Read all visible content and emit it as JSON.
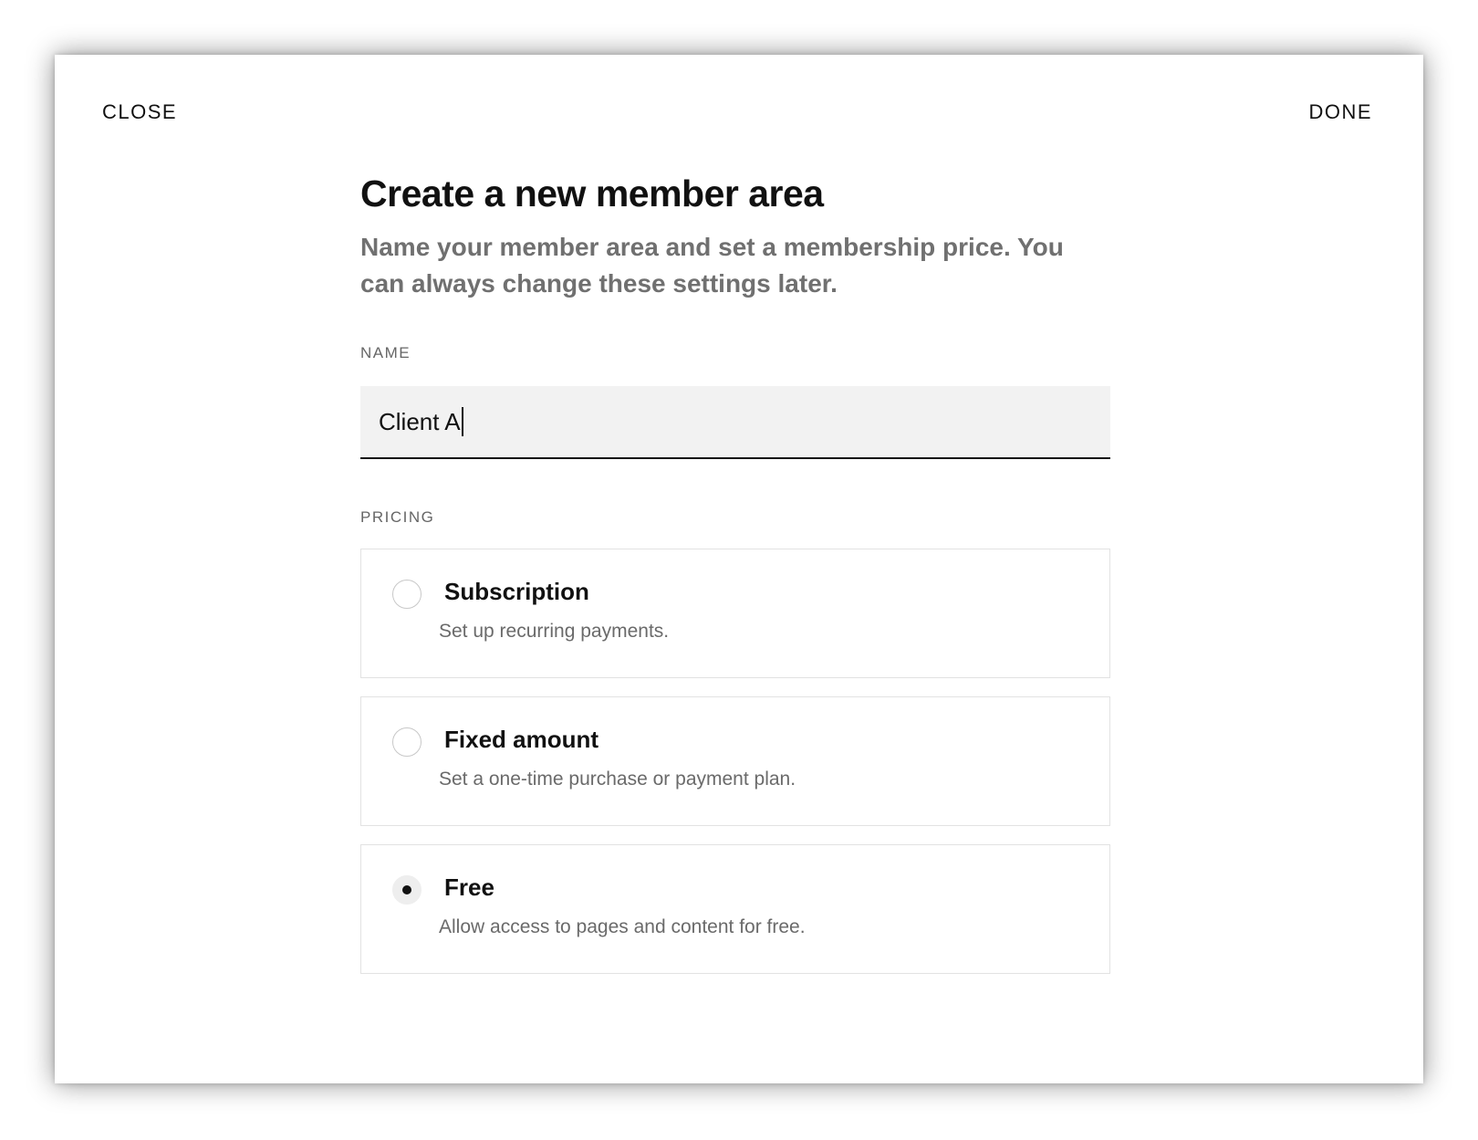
{
  "header": {
    "close_label": "CLOSE",
    "done_label": "DONE"
  },
  "main": {
    "title": "Create a new member area",
    "subtitle": "Name your member area and set a membership price. You can always change these settings later.",
    "name": {
      "label": "NAME",
      "value": "Client A"
    },
    "pricing": {
      "label": "PRICING",
      "selected": "Free",
      "options": [
        {
          "title": "Subscription",
          "description": "Set up recurring payments.",
          "checked": false
        },
        {
          "title": "Fixed amount",
          "description": "Set a one-time purchase or payment plan.",
          "checked": false
        },
        {
          "title": "Free",
          "description": "Allow access to pages and content for free.",
          "checked": true
        }
      ]
    }
  }
}
